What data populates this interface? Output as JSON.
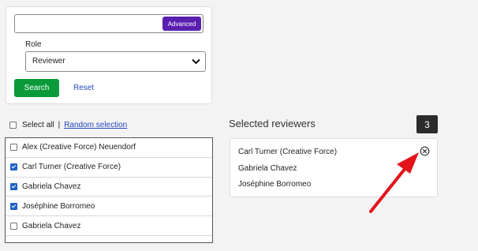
{
  "search": {
    "value": "",
    "advanced_label": "Advanced"
  },
  "role": {
    "label": "Role",
    "value": "Reviewer"
  },
  "actions": {
    "search_label": "Search",
    "reset_label": "Reset"
  },
  "list_controls": {
    "select_all_label": "Select all",
    "separator": "|",
    "random_label": "Random selection"
  },
  "reviewers": [
    {
      "name": "Alex (Creative Force) Neuendorf",
      "checked": false
    },
    {
      "name": "Carl Turner (Creative Force)",
      "checked": true
    },
    {
      "name": "Gabriela Chavez",
      "checked": true
    },
    {
      "name": "Joséphine Borromeo",
      "checked": true
    },
    {
      "name": "Gabriela Chavez",
      "checked": false
    }
  ],
  "selected": {
    "title": "Selected reviewers",
    "count": "3",
    "items": [
      "Carl Turner (Creative Force)",
      "Gabriela Chavez",
      "Joséphine Borromeo"
    ]
  },
  "colors": {
    "advanced": "#5b1fb0",
    "search_button": "#0a9a3a",
    "link": "#2247c4",
    "arrow": "#e3141b",
    "checkbox": "#1f62c4"
  }
}
